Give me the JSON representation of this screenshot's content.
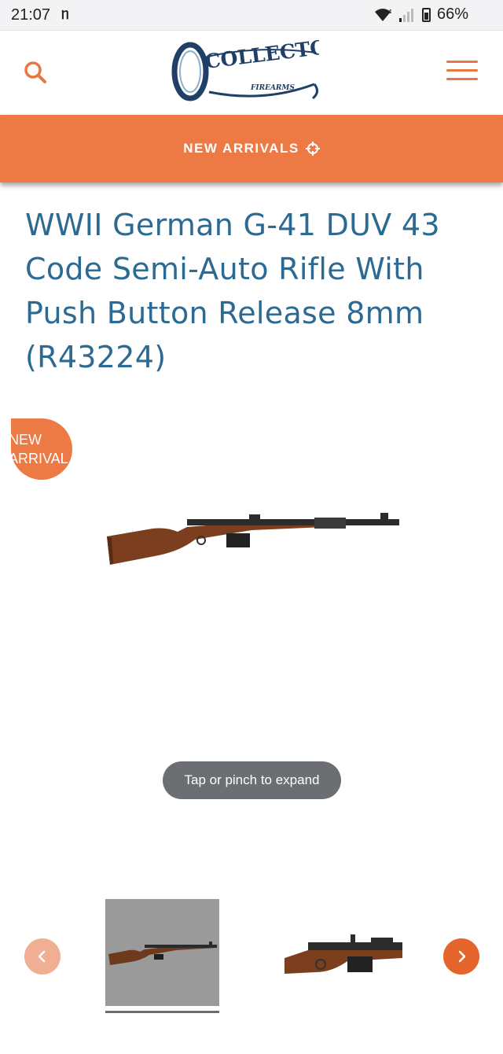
{
  "status_bar": {
    "time": "21:07",
    "download_indicator": "ᥒ",
    "battery": "66%",
    "icons": [
      "wifi-icon",
      "signal-icon",
      "battery-icon"
    ]
  },
  "header": {
    "logo_text": "COLLECTORS",
    "logo_subtext": "FIREARMS",
    "search_icon": "search-icon",
    "menu_icon": "hamburger-menu-icon"
  },
  "banner": {
    "label": "NEW ARRIVALS",
    "icon": "crosshair-icon"
  },
  "product": {
    "title": "WWII German G-41 DUV 43 Code Semi-Auto Rifle With Push Button Release 8mm (R43224)",
    "badge": "NEW\nARRIVAL",
    "expand_hint": "Tap or pinch to expand"
  },
  "thumbnails": {
    "prev_icon": "chevron-left-icon",
    "next_icon": "chevron-right-icon",
    "selected_index": 0
  },
  "colors": {
    "accent": "#ed7a45",
    "title": "#2d6a92",
    "logo": "#1f3f66"
  }
}
